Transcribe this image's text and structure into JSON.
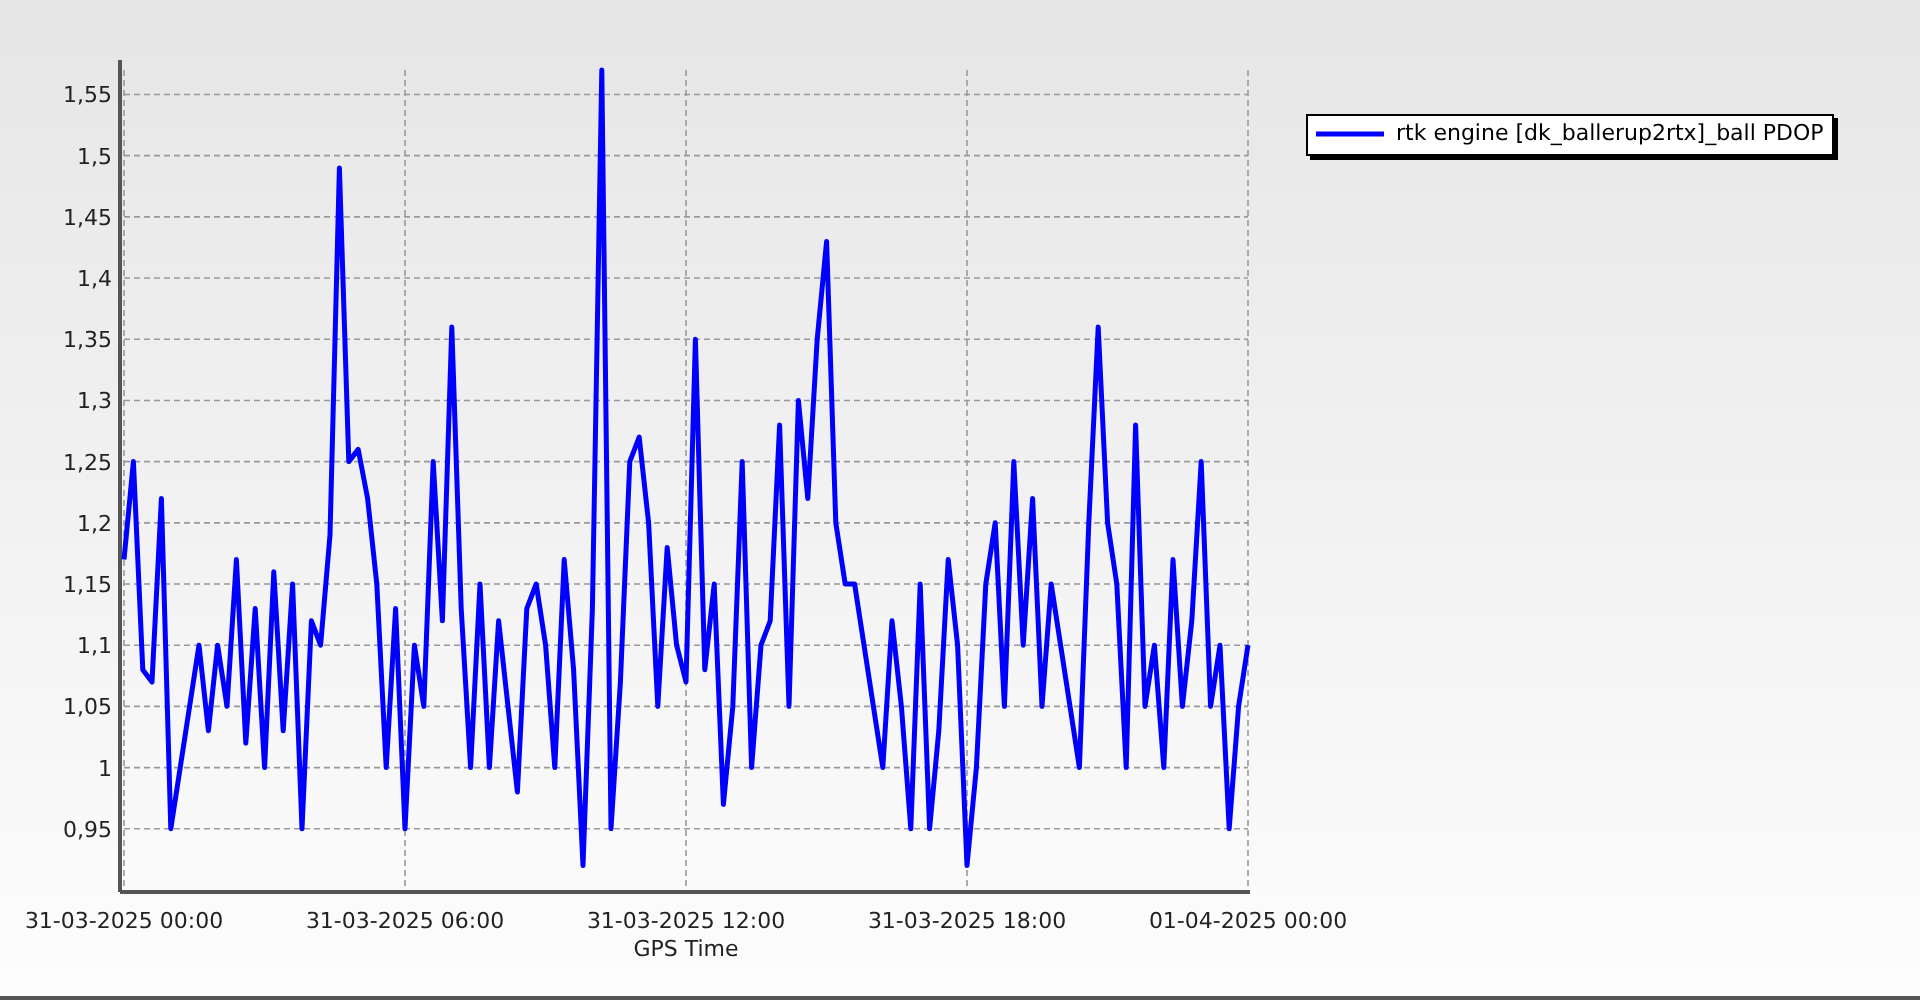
{
  "chart": {
    "chart_data": {
      "type": "line",
      "xlabel": "GPS Time",
      "grid": true,
      "ylim": [
        0.9,
        1.57
      ],
      "categories": [
        "31-03-2025 00:00",
        null,
        null,
        null,
        null,
        null,
        null,
        null,
        null,
        null,
        null,
        null,
        null,
        null,
        null,
        null,
        null,
        null,
        null,
        null,
        null,
        null,
        null,
        null,
        null,
        null,
        null,
        null,
        null,
        null,
        "31-03-2025 06:00",
        null,
        null,
        null,
        null,
        null,
        null,
        null,
        null,
        null,
        null,
        null,
        null,
        null,
        null,
        null,
        null,
        null,
        null,
        null,
        null,
        null,
        null,
        null,
        null,
        null,
        null,
        null,
        null,
        null,
        "31-03-2025 12:00",
        null,
        null,
        null,
        null,
        null,
        null,
        null,
        null,
        null,
        null,
        null,
        null,
        null,
        null,
        null,
        null,
        null,
        null,
        null,
        null,
        null,
        null,
        null,
        null,
        null,
        null,
        null,
        null,
        null,
        "31-03-2025 18:00",
        null,
        null,
        null,
        null,
        null,
        null,
        null,
        null,
        null,
        null,
        null,
        null,
        null,
        null,
        null,
        null,
        null,
        null,
        null,
        null,
        null,
        null,
        null,
        null,
        null,
        null,
        null,
        null,
        null,
        "01-04-2025 00:00"
      ],
      "yticks": [
        {
          "value": 0.95,
          "label": "0,95"
        },
        {
          "value": 1,
          "label": "1"
        },
        {
          "value": 1.05,
          "label": "1,05"
        },
        {
          "value": 1.1,
          "label": "1,1"
        },
        {
          "value": 1.15,
          "label": "1,15"
        },
        {
          "value": 1.2,
          "label": "1,2"
        },
        {
          "value": 1.25,
          "label": "1,25"
        },
        {
          "value": 1.3,
          "label": "1,3"
        },
        {
          "value": 1.35,
          "label": "1,35"
        },
        {
          "value": 1.4,
          "label": "1,4"
        },
        {
          "value": 1.45,
          "label": "1,45"
        },
        {
          "value": 1.5,
          "label": "1,5"
        },
        {
          "value": 1.55,
          "label": "1,55"
        }
      ],
      "series": [
        {
          "name": "rtk engine [dk_ballerup2rtx]_ball PDOP",
          "color": "#0000ff",
          "values": [
            1.17,
            1.25,
            1.08,
            1.07,
            1.22,
            0.95,
            1.0,
            1.05,
            1.1,
            1.03,
            1.1,
            1.05,
            1.17,
            1.02,
            1.13,
            1.0,
            1.16,
            1.03,
            1.15,
            0.95,
            1.12,
            1.1,
            1.19,
            1.49,
            1.25,
            1.26,
            1.22,
            1.15,
            1.0,
            1.13,
            0.95,
            1.1,
            1.05,
            1.25,
            1.12,
            1.36,
            1.13,
            1.0,
            1.15,
            1.0,
            1.12,
            1.05,
            0.98,
            1.13,
            1.15,
            1.1,
            1.0,
            1.17,
            1.08,
            0.92,
            1.13,
            1.57,
            0.95,
            1.07,
            1.25,
            1.27,
            1.2,
            1.05,
            1.18,
            1.1,
            1.07,
            1.35,
            1.08,
            1.15,
            0.97,
            1.05,
            1.25,
            1.0,
            1.1,
            1.12,
            1.28,
            1.05,
            1.3,
            1.22,
            1.35,
            1.43,
            1.2,
            1.15,
            1.15,
            1.1,
            1.05,
            1.0,
            1.12,
            1.05,
            0.95,
            1.15,
            0.95,
            1.03,
            1.17,
            1.1,
            0.92,
            1.0,
            1.15,
            1.2,
            1.05,
            1.25,
            1.1,
            1.22,
            1.05,
            1.15,
            1.1,
            1.05,
            1.0,
            1.2,
            1.36,
            1.2,
            1.15,
            1.0,
            1.28,
            1.05,
            1.1,
            1.0,
            1.17,
            1.05,
            1.12,
            1.25,
            1.05,
            1.1,
            0.95,
            1.05,
            1.1
          ]
        }
      ]
    }
  }
}
